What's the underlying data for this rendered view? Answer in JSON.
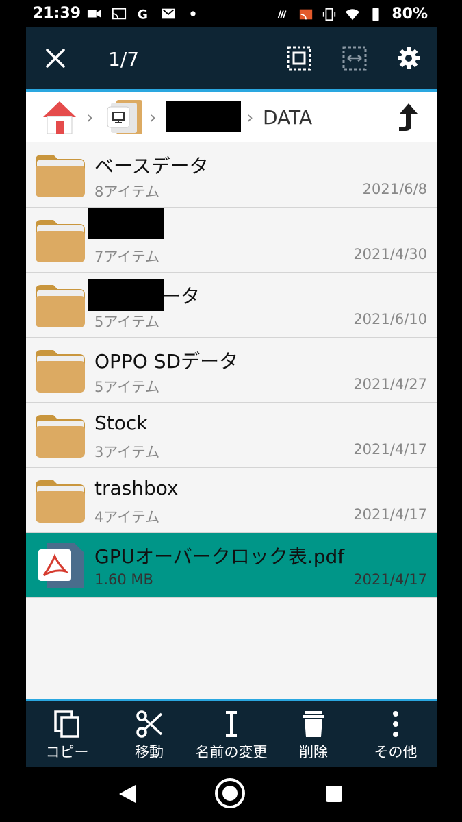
{
  "status_bar": {
    "time": "21:39",
    "battery": "80%",
    "left_icons": [
      "video-camera-icon",
      "cast-icon",
      "google-icon",
      "gmail-icon",
      "dot-icon"
    ],
    "right_icons": [
      "nfc-icon",
      "screen-cast-icon",
      "vibrate-icon",
      "wifi-icon",
      "battery-icon"
    ]
  },
  "toolbar": {
    "count": "1/7",
    "icons": [
      "close-icon",
      "select-all-icon",
      "select-range-icon",
      "settings-gear-icon"
    ]
  },
  "breadcrumb": {
    "current": "DATA",
    "icons": [
      "home-icon",
      "device-folder-icon",
      "redacted-folder",
      "up-arrow-icon"
    ]
  },
  "files": [
    {
      "name": "ベースデータ",
      "meta": "8アイテム",
      "date": "2021/6/8",
      "type": "folder"
    },
    {
      "name": "",
      "meta": "7アイテム",
      "date": "2021/4/30",
      "type": "folder"
    },
    {
      "name": "ータ",
      "meta": "5アイテム",
      "date": "2021/6/10",
      "type": "folder"
    },
    {
      "name": "OPPO SDデータ",
      "meta": "5アイテム",
      "date": "2021/4/27",
      "type": "folder"
    },
    {
      "name": "Stock",
      "meta": "3アイテム",
      "date": "2021/4/17",
      "type": "folder"
    },
    {
      "name": "trashbox",
      "meta": "4アイテム",
      "date": "2021/4/17",
      "type": "folder"
    },
    {
      "name": "GPUオーバークロック表.pdf",
      "meta": "1.60 MB",
      "date": "2021/4/17",
      "type": "pdf",
      "selected": true
    }
  ],
  "actions": {
    "copy": "コピー",
    "move": "移動",
    "rename": "名前の変更",
    "delete": "削除",
    "more": "その他"
  },
  "colors": {
    "toolbar_bg": "#0e2534",
    "accent": "#2aa7e0",
    "selected_row": "#009688",
    "folder": "#dcaa62"
  }
}
